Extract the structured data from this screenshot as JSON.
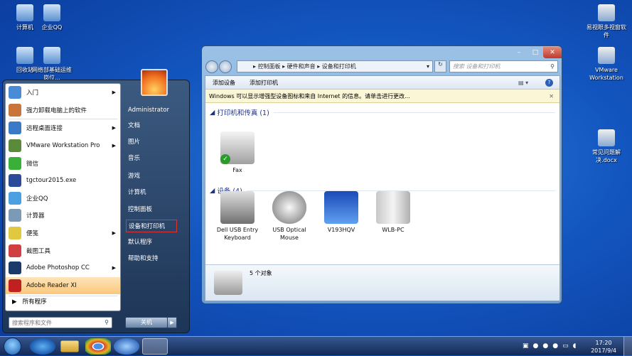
{
  "desktop_left": [
    {
      "label": "计算机",
      "icon": "computer-icon"
    },
    {
      "label": "企业QQ",
      "icon": "qq-icon"
    },
    {
      "label": "回收站",
      "icon": "recycle-bin-icon"
    },
    {
      "label": "网络部基础运维岗位...",
      "icon": "excel-file-icon"
    }
  ],
  "desktop_right": [
    {
      "label": "易视眼多视窗软件",
      "icon": "app-icon"
    },
    {
      "label": "VMware Workstation",
      "icon": "vmware-icon"
    },
    {
      "label": "常见问题解决.docx",
      "icon": "word-file-icon"
    }
  ],
  "start_menu": {
    "programs": [
      {
        "label": "入门",
        "arrow": true,
        "color": "#4a8bd8"
      },
      {
        "label": "强力卸载电脑上的软件",
        "arrow": false,
        "color": "#c9743a"
      },
      {
        "label": "远程桌面连接",
        "arrow": true,
        "color": "#3a78c8"
      },
      {
        "label": "VMware Workstation Pro",
        "arrow": true,
        "color": "#5a8a3a"
      },
      {
        "label": "微信",
        "arrow": false,
        "color": "#3ab03a"
      },
      {
        "label": "tgctour2015.exe",
        "arrow": false,
        "color": "#2a4a9a"
      },
      {
        "label": "企业QQ",
        "arrow": false,
        "color": "#4aa0e0"
      },
      {
        "label": "计算器",
        "arrow": false,
        "color": "#7a9ab8"
      },
      {
        "label": "便笺",
        "arrow": true,
        "color": "#e0c840"
      },
      {
        "label": "截图工具",
        "arrow": false,
        "color": "#d04040"
      },
      {
        "label": "Adobe Photoshop CC",
        "arrow": true,
        "color": "#1a3a6a"
      },
      {
        "label": "Adobe Reader XI",
        "arrow": false,
        "color": "#c02020",
        "selected": true
      }
    ],
    "all_programs": "所有程序",
    "search_placeholder": "搜索程序和文件",
    "right_items": [
      "Administrator",
      "文档",
      "图片",
      "音乐",
      "游戏",
      "计算机",
      "控制面板",
      "设备和打印机",
      "默认程序",
      "帮助和支持"
    ],
    "highlighted_right": "设备和打印机",
    "shutdown": "关机"
  },
  "window": {
    "breadcrumb": [
      "控制面板",
      "硬件和声音",
      "设备和打印机"
    ],
    "search_placeholder": "搜索 设备和打印机",
    "commands": [
      "添加设备",
      "添加打印机"
    ],
    "infobar": "Windows 可以显示增强型设备图标和来自 Internet 的信息。请单击进行更改...",
    "groups": [
      {
        "title": "打印机和传真 (1)",
        "devices": [
          {
            "name": "Fax",
            "icon": "fax-icon",
            "default": true
          }
        ]
      },
      {
        "title": "设备 (4)",
        "devices": [
          {
            "name": "Dell USB Entry Keyboard",
            "icon": "keyboard-icon"
          },
          {
            "name": "USB Optical Mouse",
            "icon": "mouse-icon"
          },
          {
            "name": "V193HQV",
            "icon": "monitor-icon"
          },
          {
            "name": "WLB-PC",
            "icon": "computer-tower-icon"
          }
        ]
      }
    ],
    "details": "5 个对象"
  },
  "taskbar": {
    "time": "17:20",
    "date": "2017/9/4"
  }
}
